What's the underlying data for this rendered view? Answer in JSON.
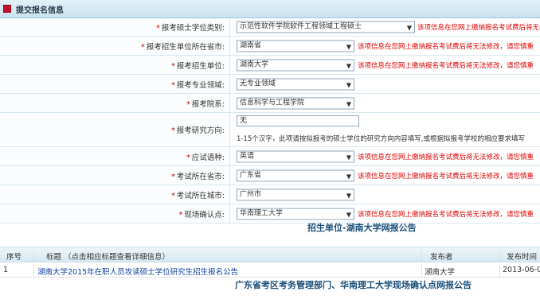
{
  "panel": {
    "title": "提交报名信息"
  },
  "fields": [
    {
      "label": "报考硕士学位类别:",
      "value": "示范性软件学院软件工程领域工程硕士",
      "warning": "该项信息在您网上缴纳报名考试费后将无法修改"
    },
    {
      "label": "报考招生单位所在省市:",
      "value": "湖南省",
      "warning": "该项信息在您网上缴纳报名考试费后将无法修改，请您慎重"
    },
    {
      "label": "报考招生单位:",
      "value": "湖南大学",
      "warning": "该项信息在您网上缴纳报名考试费后将无法修改，请您慎重"
    },
    {
      "label": "报考专业领域:",
      "value": "无专业领域",
      "warning": ""
    },
    {
      "label": "报考院系:",
      "value": "信息科学与工程学院",
      "warning": ""
    },
    {
      "label": "报考研究方向:",
      "value": "无",
      "hint": "1-15个汉字，此项请按拟报考的硕士学位的研究方向内容填写,或根据拟报考学校的相应要求填写"
    },
    {
      "label": "应试语种:",
      "value": "英语",
      "warning": "该项信息在您网上缴纳报名考试费后将无法修改，请您慎重"
    },
    {
      "label": "考试所在省市:",
      "value": "广东省",
      "warning": "该项信息在您网上缴纳报名考试费后将无法修改，请您慎重"
    },
    {
      "label": "考试所在城市:",
      "value": "广州市",
      "warning": ""
    },
    {
      "label": "现场确认点:",
      "value": "华南理工大学",
      "warning": "该项信息在您网上缴纳报名考试费后将无法修改，请您慎重"
    }
  ],
  "announce1": {
    "title": "招生单位-湖南大学网报公告"
  },
  "table": {
    "headers": [
      "序号",
      "标题 （点击相应标题查看详细信息）",
      "发布者",
      "发布时间"
    ],
    "rows": [
      {
        "no": "1",
        "title": "湖南大学2015年在职人员攻读硕士学位研究生招生报名公告",
        "publisher": "湖南大学",
        "date": "2013-06-0"
      }
    ]
  },
  "announce2": {
    "title": "广东省考区考务管理部门、华南理工大学现场确认点网报公告"
  }
}
